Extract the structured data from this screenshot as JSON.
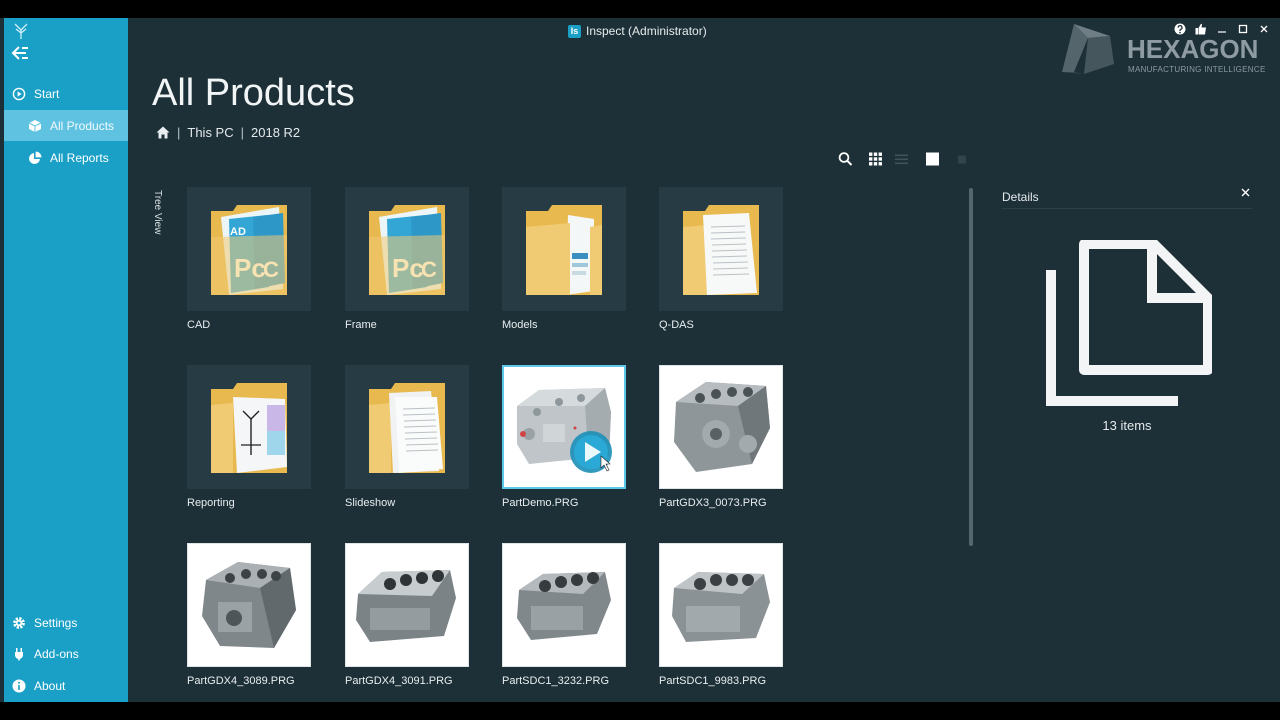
{
  "window": {
    "title": "Inspect (Administrator)",
    "badge": "Is"
  },
  "brand": {
    "name": "HEXAGON",
    "tagline": "MANUFACTURING INTELLIGENCE"
  },
  "sidebar": {
    "items": [
      {
        "label": "Start",
        "icon": "play-circle-icon"
      },
      {
        "label": "All Products",
        "icon": "cube-icon"
      },
      {
        "label": "All Reports",
        "icon": "pie-chart-icon"
      }
    ],
    "bottom": [
      {
        "label": "Settings",
        "icon": "gear-icon"
      },
      {
        "label": "Add-ons",
        "icon": "plug-icon"
      },
      {
        "label": "About",
        "icon": "info-icon"
      }
    ]
  },
  "page": {
    "title": "All Products"
  },
  "breadcrumb": {
    "items": [
      "This PC",
      "2018 R2"
    ]
  },
  "tree_view": {
    "label": "Tree View"
  },
  "tiles": [
    {
      "label": "CAD",
      "kind": "folder-pc"
    },
    {
      "label": "Frame",
      "kind": "folder-pc"
    },
    {
      "label": "Models",
      "kind": "folder-doc"
    },
    {
      "label": "Q-DAS",
      "kind": "folder-doc"
    },
    {
      "label": "Reporting",
      "kind": "folder-report"
    },
    {
      "label": "Slideshow",
      "kind": "folder-doc"
    },
    {
      "label": "PartDemo.PRG",
      "kind": "photo"
    },
    {
      "label": "PartGDX3_0073.PRG",
      "kind": "photo"
    },
    {
      "label": "PartGDX4_3089.PRG",
      "kind": "photo"
    },
    {
      "label": "PartGDX4_3091.PRG",
      "kind": "photo"
    },
    {
      "label": "PartSDC1_3232.PRG",
      "kind": "photo"
    },
    {
      "label": "PartSDC1_9983.PRG",
      "kind": "photo"
    }
  ],
  "details": {
    "title": "Details",
    "count": "13 items"
  },
  "colors": {
    "sidebar": "#1aa0c6",
    "active": "#5fc2e0",
    "background": "#1d2f37",
    "folder": "#f1cb73"
  }
}
